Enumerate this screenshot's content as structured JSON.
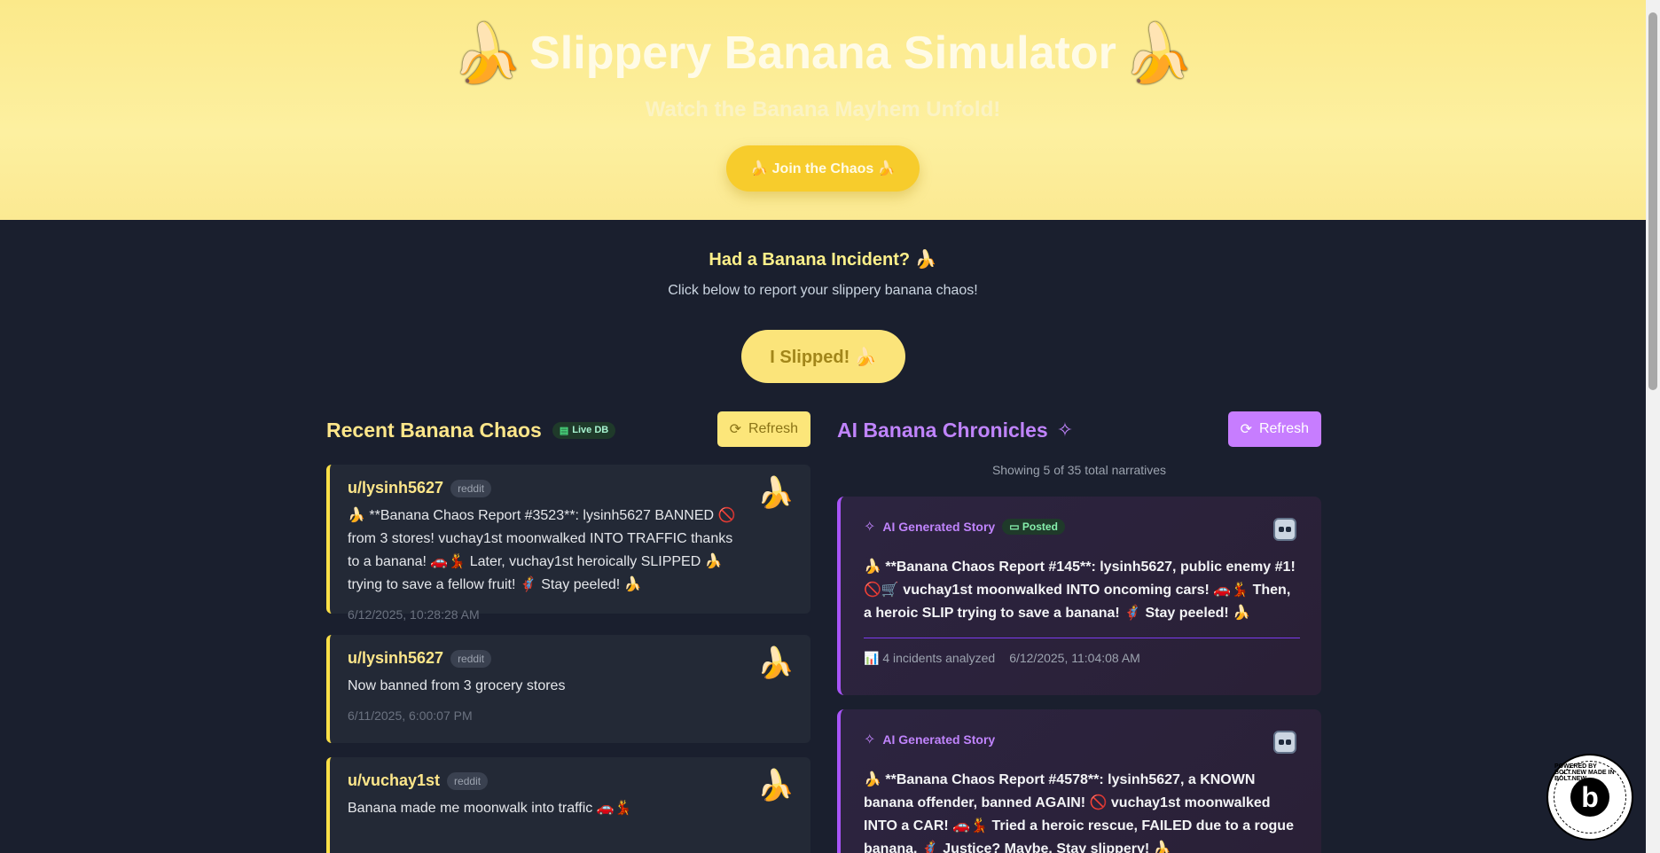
{
  "hero": {
    "emoji_left": "🍌",
    "title": "Slippery Banana Simulator",
    "emoji_right": "🍌",
    "subtitle": "Watch the Banana Mayhem Unfold!",
    "join_button": "🍌 Join the Chaos 🍌"
  },
  "incident": {
    "title": "Had a Banana Incident? 🍌",
    "subtitle": "Click below to report your slippery banana chaos!",
    "slip_button": "I Slipped! 🍌"
  },
  "recent": {
    "title": "Recent Banana Chaos",
    "badge": "Live DB",
    "refresh": "Refresh",
    "cards": [
      {
        "user": "u/lysinh5627",
        "source": "reddit",
        "emoji": "🍌",
        "text": "🍌 **Banana Chaos Report #3523**: lysinh5627 BANNED 🚫 from 3 stores! vuchay1st moonwalked INTO TRAFFIC thanks to a banana! 🚗💃 Later, vuchay1st heroically SLIPPED 🍌 trying to save a fellow fruit! 🦸 Stay peeled! 🍌",
        "time": "6/12/2025, 10:28:28 AM"
      },
      {
        "user": "u/lysinh5627",
        "source": "reddit",
        "emoji": "🍌",
        "text": "Now banned from 3 grocery stores",
        "time": "6/11/2025, 6:00:07 PM"
      },
      {
        "user": "u/vuchay1st",
        "source": "reddit",
        "emoji": "🍌",
        "text": "Banana made me moonwalk into traffic 🚗💃",
        "time": ""
      }
    ]
  },
  "ai": {
    "title": "AI Banana Chronicles",
    "refresh": "Refresh",
    "showing": "Showing 5 of 35 total narratives",
    "cards": [
      {
        "label": "AI Generated Story",
        "status": "Posted",
        "text": "🍌 **Banana Chaos Report #145**: lysinh5627, public enemy #1! 🚫🛒 vuchay1st moonwalked INTO oncoming cars! 🚗💃 Then, a heroic SLIP trying to save a banana! 🦸 Stay peeled! 🍌",
        "incidents": "📊 4 incidents analyzed",
        "time": "6/12/2025, 11:04:08 AM"
      },
      {
        "label": "AI Generated Story",
        "status": "",
        "text": "🍌 **Banana Chaos Report #4578**: lysinh5627, a KNOWN banana offender, banned AGAIN! 🚫 vuchay1st moonwalked INTO a CAR! 🚗💃 Tried a heroic rescue, FAILED due to a rogue banana. 🦸 Justice? Maybe. Stay slippery! 🍌",
        "incidents": "",
        "time": ""
      }
    ]
  },
  "bolt": {
    "ring_text": "POWERED BY BOLT.NEW MADE IN BOLT.NEW",
    "letter": "b"
  }
}
